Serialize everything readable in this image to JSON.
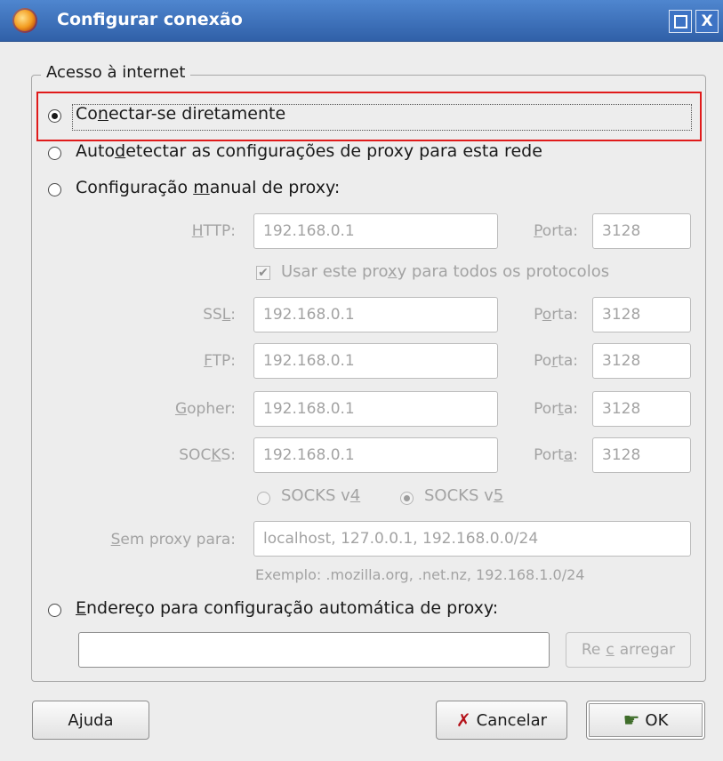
{
  "window": {
    "title": "Configurar conexão",
    "buttons": {
      "maximize_icon": "maximize-icon",
      "close_label": "X"
    }
  },
  "access": {
    "group_label": "Acesso à internet",
    "direct": {
      "pre": "Co",
      "accel": "n",
      "post": "ectar-se diretamente",
      "checked": true
    },
    "auto_detect": {
      "pre": "Auto",
      "accel": "d",
      "post": "etectar as configurações de proxy para esta rede",
      "checked": false
    },
    "manual": {
      "pre": "Configuração ",
      "accel": "m",
      "post": "anual de proxy:",
      "checked": false
    }
  },
  "proxy": {
    "http": {
      "label_pre": "",
      "label_accel": "H",
      "label_post": "TTP:",
      "value": "192.168.0.1",
      "port_pre": "",
      "port_accel": "P",
      "port_post": "orta:",
      "port": "3128"
    },
    "use_for_all": {
      "pre": "Usar este pro",
      "accel": "x",
      "post": "y para todos os protocolos",
      "checked": true
    },
    "ssl": {
      "label_pre": "SS",
      "label_accel": "L",
      "label_post": ":",
      "value": "192.168.0.1",
      "port_pre": "P",
      "port_accel": "o",
      "port_post": "rta:",
      "port": "3128"
    },
    "ftp": {
      "label_pre": "",
      "label_accel": "F",
      "label_post": "TP:",
      "value": "192.168.0.1",
      "port_pre": "Po",
      "port_accel": "r",
      "port_post": "ta:",
      "port": "3128"
    },
    "gopher": {
      "label_pre": "",
      "label_accel": "G",
      "label_post": "opher:",
      "value": "192.168.0.1",
      "port_pre": "Por",
      "port_accel": "t",
      "port_post": "a:",
      "port": "3128"
    },
    "socks": {
      "label_pre": "SOC",
      "label_accel": "K",
      "label_post": "S:",
      "value": "192.168.0.1",
      "port_pre": "Port",
      "port_accel": "a",
      "port_post": ":",
      "port": "3128"
    },
    "socks_v4": {
      "pre": "SOCKS v",
      "accel": "4",
      "post": "",
      "checked": false
    },
    "socks_v5": {
      "pre": "SOCKS v",
      "accel": "5",
      "post": "",
      "checked": true
    },
    "no_proxy": {
      "label_pre": "",
      "label_accel": "S",
      "label_post": "em proxy para:",
      "value": "localhost, 127.0.0.1, 192.168.0.0/24"
    },
    "example": "Exemplo: .mozilla.org, .net.nz, 192.168.1.0/24"
  },
  "auto_config": {
    "radio": {
      "pre": "",
      "accel": "E",
      "post": "ndereço para configuração automática de proxy:",
      "checked": false
    },
    "url_value": "",
    "reload": {
      "pre": "Re",
      "accel": "c",
      "post": "arregar"
    }
  },
  "footer": {
    "help_label": "Ajuda",
    "cancel_label": "Cancelar",
    "cancel_icon": "cancel-x-icon",
    "ok_label": "OK",
    "ok_icon": "ok-hand-icon"
  },
  "colors": {
    "titlebar": "#3d73c4",
    "highlight": "#e01b1b",
    "disabled_text": "#a3a3a3"
  }
}
